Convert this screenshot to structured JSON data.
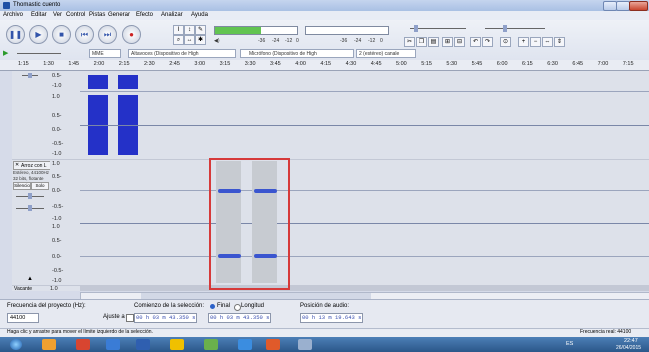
{
  "window": {
    "title": "Thomastic cuento"
  },
  "menu": [
    "Archivo",
    "Editar",
    "Ver",
    "Control",
    "Pistas",
    "Generar",
    "Efecto",
    "Analizar",
    "Ayuda"
  ],
  "toolbar": {
    "device_label": "MME",
    "output_device": "Altavoces (Dispositivo de High",
    "input_device": "Micrófono (Dispositivo de High",
    "channels": "2 (estéreo) canale",
    "meter_ticks": [
      "-36",
      "-24",
      "-12",
      "0"
    ]
  },
  "ruler": {
    "labels": [
      "1:15",
      "1:30",
      "1:45",
      "2:00",
      "2:15",
      "2:30",
      "2:45",
      "3:00",
      "3:15",
      "3:30",
      "3:45",
      "4:00",
      "4:15",
      "4:30",
      "4:45",
      "5:00",
      "5:15",
      "5:30",
      "5:45",
      "6:00",
      "6:15",
      "6:30",
      "6:45",
      "7:00",
      "7:15"
    ]
  },
  "track1": {
    "scale": [
      "0.5-",
      "-1.0",
      "1.0",
      "0.5-",
      "0.0-",
      "-0.5-",
      "-1.0"
    ]
  },
  "track2": {
    "name": "Arroz con L",
    "info": [
      "Estéreo, 44100Hz",
      "32 bits, flotante"
    ],
    "silence": "Silencio",
    "solo": "Solo",
    "scale": [
      "1.0",
      "0.5-",
      "0.0-",
      "-0.5-",
      "-1.0",
      "1.0",
      "0.5-",
      "0.0-",
      "-0.5-",
      "-1.0"
    ]
  },
  "track3": {
    "name": "Vacante",
    "scale": "1.0"
  },
  "bottom": {
    "rate_label": "Frecuencia del proyecto (Hz):",
    "rate_value": "44100",
    "snap_label": "Ajuste a",
    "selection_label": "Comienzo de la selección:",
    "end_option": "Final",
    "length_option": "Longitud",
    "start_time": "00 h 03 m 43.350 s",
    "end_time": "00 h 03 m 43.350 s",
    "position_label": "Posición de audio:",
    "position_time": "00 h 13 m 19.643 s"
  },
  "status": {
    "hint": "Haga clic y arrastre para mover el límite izquierdo de la selección.",
    "rate": "Frecuencia real: 44100"
  },
  "taskbar": {
    "lang": "ES",
    "time": "22:47",
    "date": "26/04/2015"
  }
}
